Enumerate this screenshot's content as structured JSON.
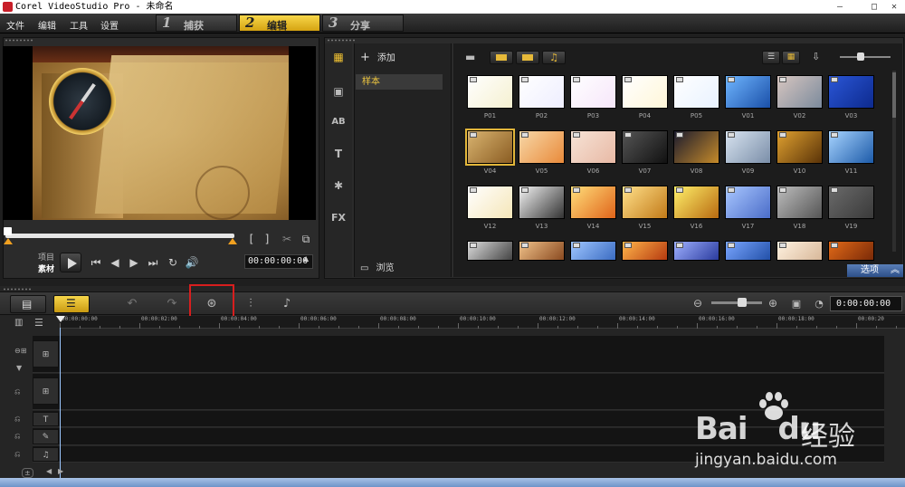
{
  "window": {
    "title": "Corel VideoStudio Pro - 未命名",
    "minimize": "–",
    "maximize": "□",
    "close": "✕"
  },
  "menu": [
    "文件",
    "编辑",
    "工具",
    "设置"
  ],
  "steps": [
    {
      "num": "1",
      "label": "捕获"
    },
    {
      "num": "2",
      "label": "编辑"
    },
    {
      "num": "3",
      "label": "分享"
    }
  ],
  "preview": {
    "mode_project": "项目",
    "mode_clip": "素材",
    "timecode": "00:00:00:00",
    "mark_in": "[",
    "mark_out": "]"
  },
  "library": {
    "add_label": "添加",
    "folder_item": "样本",
    "browse_label": "浏览",
    "options_label": "选项",
    "thumbnails": [
      {
        "label": "P01",
        "colors": [
          "#fff",
          "#f5f0d0"
        ]
      },
      {
        "label": "P02",
        "colors": [
          "#fff",
          "#eef"
        ]
      },
      {
        "label": "P03",
        "colors": [
          "#fff",
          "#f6e6fa"
        ]
      },
      {
        "label": "P04",
        "colors": [
          "#fff",
          "#fff6d8"
        ]
      },
      {
        "label": "P05",
        "colors": [
          "#fff",
          "#e8f2ff"
        ]
      },
      {
        "label": "V01",
        "colors": [
          "#6fb6ff",
          "#1a4fa8"
        ]
      },
      {
        "label": "V02",
        "colors": [
          "#d7c6c0",
          "#7b8a9c"
        ]
      },
      {
        "label": "V03",
        "colors": [
          "#2a56d6",
          "#0d2a8e"
        ]
      },
      {
        "label": "V04",
        "colors": [
          "#d9b470",
          "#8a5c22"
        ]
      },
      {
        "label": "V05",
        "colors": [
          "#f7d8a8",
          "#e98a3a"
        ]
      },
      {
        "label": "V06",
        "colors": [
          "#f6e3d6",
          "#e8b9a5"
        ]
      },
      {
        "label": "V07",
        "colors": [
          "#555",
          "#111"
        ]
      },
      {
        "label": "V08",
        "colors": [
          "#1b1b2e",
          "#c58a2a"
        ]
      },
      {
        "label": "V09",
        "colors": [
          "#d8e3f0",
          "#7a8ea8"
        ]
      },
      {
        "label": "V10",
        "colors": [
          "#e0a130",
          "#5a3308"
        ]
      },
      {
        "label": "V11",
        "colors": [
          "#a8d4ff",
          "#1c5aa8"
        ]
      },
      {
        "label": "V12",
        "colors": [
          "#fff",
          "#f5e6b8"
        ]
      },
      {
        "label": "V13",
        "colors": [
          "#f3f3f3",
          "#333"
        ]
      },
      {
        "label": "V14",
        "colors": [
          "#ffde7a",
          "#e0641a"
        ]
      },
      {
        "label": "V15",
        "colors": [
          "#ffe08a",
          "#c27a18"
        ]
      },
      {
        "label": "V16",
        "colors": [
          "#fff06a",
          "#b86a10"
        ]
      },
      {
        "label": "V17",
        "colors": [
          "#a9c7ff",
          "#4a6cc8"
        ]
      },
      {
        "label": "V18",
        "colors": [
          "#bdbdbd",
          "#555"
        ]
      },
      {
        "label": "V19",
        "colors": [
          "#6a6a6a",
          "#3a3a3a"
        ]
      },
      {
        "label": "",
        "colors": [
          "#ddd",
          "#444"
        ]
      },
      {
        "label": "",
        "colors": [
          "#f0c28a",
          "#8a4a20"
        ]
      },
      {
        "label": "",
        "colors": [
          "#9fc6ff",
          "#3b6cc2"
        ]
      },
      {
        "label": "",
        "colors": [
          "#ffb54a",
          "#b53a10"
        ]
      },
      {
        "label": "",
        "colors": [
          "#9fb0ff",
          "#2a3b9e"
        ]
      },
      {
        "label": "",
        "colors": [
          "#7aa6ff",
          "#2250a8"
        ]
      },
      {
        "label": "",
        "colors": [
          "#fff2e0",
          "#d8b89a"
        ]
      },
      {
        "label": "",
        "colors": [
          "#e26a18",
          "#7a2a08"
        ]
      }
    ]
  },
  "timeline": {
    "timecode": "0:00:00:00",
    "ruler": [
      "00:00:00:00",
      "00:00:02:00",
      "00:00:04:00",
      "00:00:06:00",
      "00:00:08:00",
      "00:00:10:00",
      "00:00:12:00",
      "00:00:14:00",
      "00:00:16:00",
      "00:00:18:00",
      "00:00:20"
    ],
    "zoom": 0.6
  },
  "watermark": {
    "brand": "Bai",
    "brand2": "du",
    "cn": "经验",
    "url": "jingyan.baidu.com"
  }
}
